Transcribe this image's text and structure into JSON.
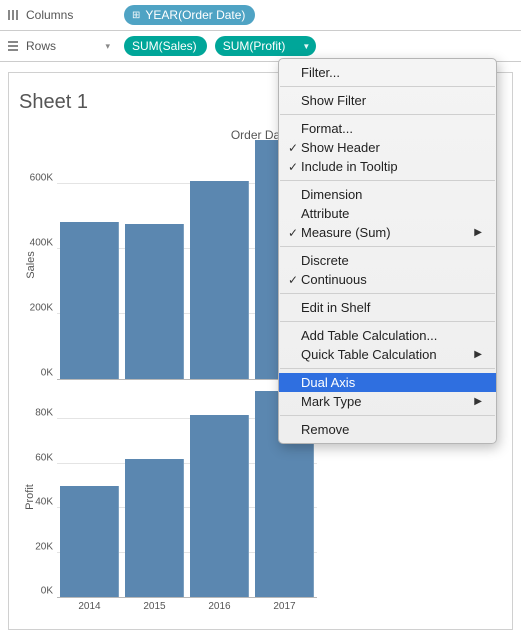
{
  "shelves": {
    "columns_label": "Columns",
    "rows_label": "Rows",
    "columns_pill": "YEAR(Order Date)",
    "rows_pill_1": "SUM(Sales)",
    "rows_pill_2": "SUM(Profit)"
  },
  "sheet": {
    "title": "Sheet 1",
    "chart_title": "Order Date",
    "y1_label": "Sales",
    "y2_label": "Profit"
  },
  "context_menu": {
    "filter": "Filter...",
    "show_filter": "Show Filter",
    "format": "Format...",
    "show_header": "Show Header",
    "include_tooltip": "Include in Tooltip",
    "dimension": "Dimension",
    "attribute": "Attribute",
    "measure": "Measure (Sum)",
    "discrete": "Discrete",
    "continuous": "Continuous",
    "edit_in_shelf": "Edit in Shelf",
    "add_table_calc": "Add Table Calculation...",
    "quick_table_calc": "Quick Table Calculation",
    "dual_axis": "Dual Axis",
    "mark_type": "Mark Type",
    "remove": "Remove"
  },
  "chart_data": [
    {
      "type": "bar",
      "title": "Order Date",
      "ylabel": "Sales",
      "categories": [
        "2014",
        "2015",
        "2016",
        "2017"
      ],
      "values": [
        485000,
        475000,
        610000,
        735000
      ],
      "ylim": [
        0,
        700000
      ],
      "yticks": [
        "0K",
        "200K",
        "400K",
        "600K"
      ]
    },
    {
      "type": "bar",
      "ylabel": "Profit",
      "categories": [
        "2014",
        "2015",
        "2016",
        "2017"
      ],
      "values": [
        50000,
        62000,
        82000,
        93000
      ],
      "ylim": [
        0,
        90000
      ],
      "yticks": [
        "0K",
        "20K",
        "40K",
        "60K",
        "80K"
      ]
    }
  ],
  "xticks": {
    "0": "2014",
    "1": "2015",
    "2": "2016",
    "3": "2017"
  },
  "yticks_top": {
    "0": "0K",
    "1": "200K",
    "2": "400K",
    "3": "600K"
  },
  "yticks_bot": {
    "0": "0K",
    "1": "20K",
    "2": "40K",
    "3": "60K",
    "4": "80K"
  }
}
